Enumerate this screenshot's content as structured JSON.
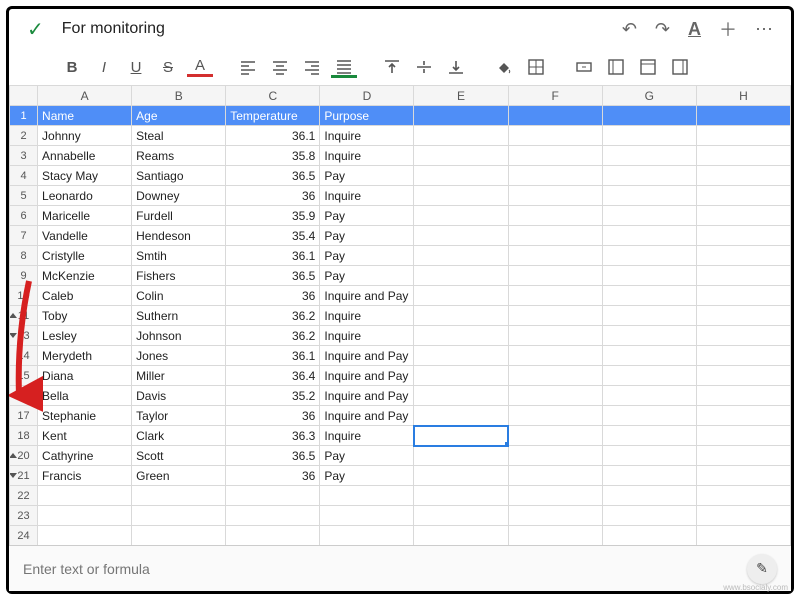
{
  "title": "For monitoring",
  "formula_placeholder": "Enter text or formula",
  "columns": [
    "A",
    "B",
    "C",
    "D",
    "E",
    "F",
    "G",
    "H"
  ],
  "header_row": {
    "a": "Name",
    "b": "Age",
    "c": "Temperature",
    "d": "Purpose"
  },
  "row_numbers": [
    1,
    2,
    3,
    4,
    5,
    6,
    7,
    8,
    9,
    10,
    11,
    13,
    14,
    15,
    16,
    17,
    18,
    20,
    21,
    22,
    23,
    24
  ],
  "rows": [
    {
      "a": "Name",
      "b": "Age",
      "c": "Temperature",
      "d": "Purpose",
      "hdr": true
    },
    {
      "a": "Johnny",
      "b": "Steal",
      "c": "36.1",
      "d": "Inquire"
    },
    {
      "a": "Annabelle",
      "b": "Reams",
      "c": "35.8",
      "d": "Inquire"
    },
    {
      "a": "Stacy May",
      "b": "Santiago",
      "c": "36.5",
      "d": "Pay"
    },
    {
      "a": "Leonardo",
      "b": "Downey",
      "c": "36",
      "d": "Inquire"
    },
    {
      "a": "Maricelle",
      "b": "Furdell",
      "c": "35.9",
      "d": "Pay"
    },
    {
      "a": "Vandelle",
      "b": "Hendeson",
      "c": "35.4",
      "d": "Pay"
    },
    {
      "a": "Cristylle",
      "b": "Smtih",
      "c": "36.1",
      "d": "Pay"
    },
    {
      "a": "McKenzie",
      "b": "Fishers",
      "c": "36.5",
      "d": "Pay"
    },
    {
      "a": "Caleb",
      "b": "Colin",
      "c": "36",
      "d": "Inquire and Pay"
    },
    {
      "a": "Toby",
      "b": "Suthern",
      "c": "36.2",
      "d": "Inquire"
    },
    {
      "a": "Lesley",
      "b": "Johnson",
      "c": "36.2",
      "d": "Inquire"
    },
    {
      "a": "Merydeth",
      "b": "Jones",
      "c": "36.1",
      "d": "Inquire and Pay"
    },
    {
      "a": "Diana",
      "b": "Miller",
      "c": "36.4",
      "d": "Inquire and Pay"
    },
    {
      "a": "Bella",
      "b": "Davis",
      "c": "35.2",
      "d": "Inquire and Pay"
    },
    {
      "a": "Stephanie",
      "b": "Taylor",
      "c": "36",
      "d": "Inquire and Pay"
    },
    {
      "a": "Kent",
      "b": "Clark",
      "c": "36.3",
      "d": "Inquire"
    },
    {
      "a": "Cathyrine",
      "b": "Scott",
      "c": "36.5",
      "d": "Pay"
    },
    {
      "a": "Francis",
      "b": "Green",
      "c": "36",
      "d": "Pay"
    },
    {
      "a": "",
      "b": "",
      "c": "",
      "d": ""
    },
    {
      "a": "",
      "b": "",
      "c": "",
      "d": ""
    },
    {
      "a": "",
      "b": "",
      "c": "",
      "d": ""
    }
  ],
  "selected_cell": {
    "row_index": 16,
    "col": "E"
  },
  "group_markers": {
    "up": [
      10,
      17
    ],
    "down": [
      11,
      18
    ]
  },
  "toolbar": {
    "bold": "B",
    "italic": "I",
    "underline": "U",
    "strike": "S",
    "textcolor": "A",
    "align_left": "al",
    "align_center": "ac",
    "align_right": "ar",
    "align_justify": "aj",
    "valign_top": "vt",
    "valign_mid": "vm",
    "valign_bot": "vb",
    "fill": "fill",
    "borders": "bd",
    "merge": "mg",
    "freeze": "fz",
    "wrap": "wr",
    "rotate": "rt"
  },
  "topright": {
    "undo": "↶",
    "redo": "↷",
    "font": "A",
    "add": "+",
    "more": "⋯"
  }
}
